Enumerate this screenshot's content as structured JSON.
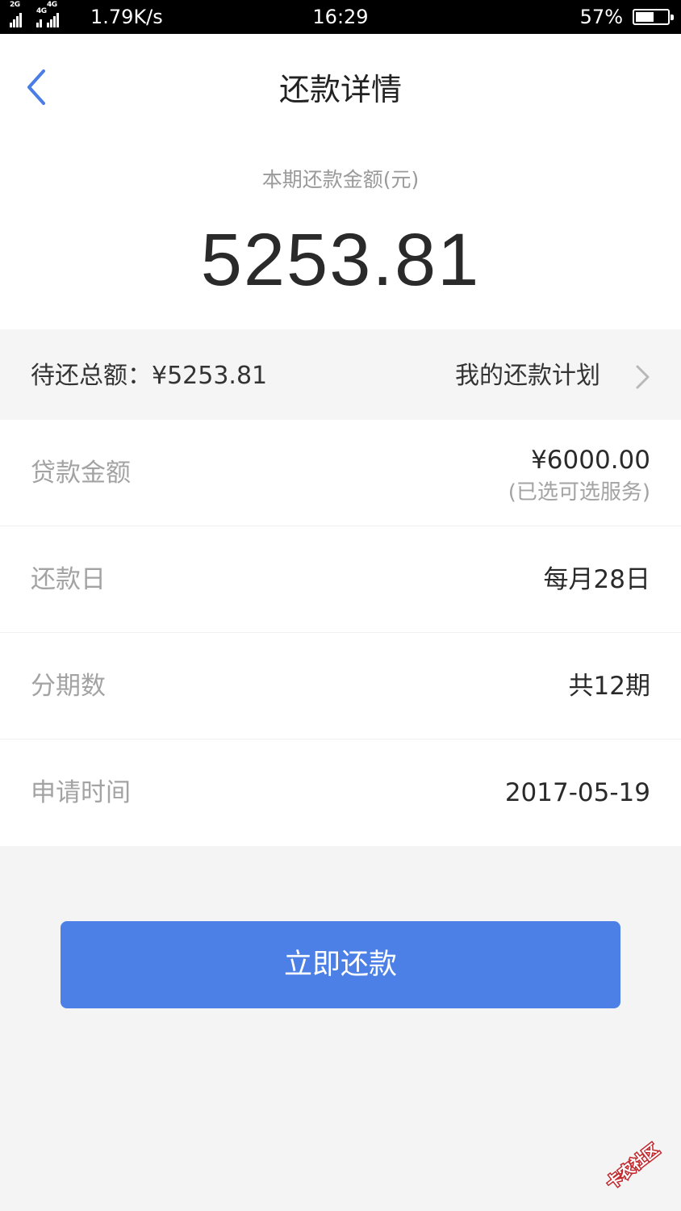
{
  "status_bar": {
    "net1": "2G",
    "net2": "4G",
    "net3": "4G",
    "speed": "1.79K/s",
    "time": "16:29",
    "battery_pct": "57%",
    "battery_level": 0.57
  },
  "header": {
    "title": "还款详情",
    "back_icon": "chevron-left-icon"
  },
  "summary": {
    "amount_label": "本期还款金额(元)",
    "amount": "5253.81"
  },
  "plan": {
    "total_text": "待还总额：¥5253.81",
    "plan_link": "我的还款计划",
    "chevron_icon": "chevron-right-icon"
  },
  "details": [
    {
      "label": "贷款金额",
      "value": "¥6000.00",
      "sub": "(已选可选服务)"
    },
    {
      "label": "还款日",
      "value": "每月28日"
    },
    {
      "label": "分期数",
      "value": "共12期"
    },
    {
      "label": "申请时间",
      "value": "2017-05-19"
    }
  ],
  "actions": {
    "pay_button": "立即还款"
  },
  "watermark": {
    "text": "卡农社区"
  },
  "colors": {
    "accent": "#4c80e7",
    "back_icon": "#4a7de6"
  }
}
